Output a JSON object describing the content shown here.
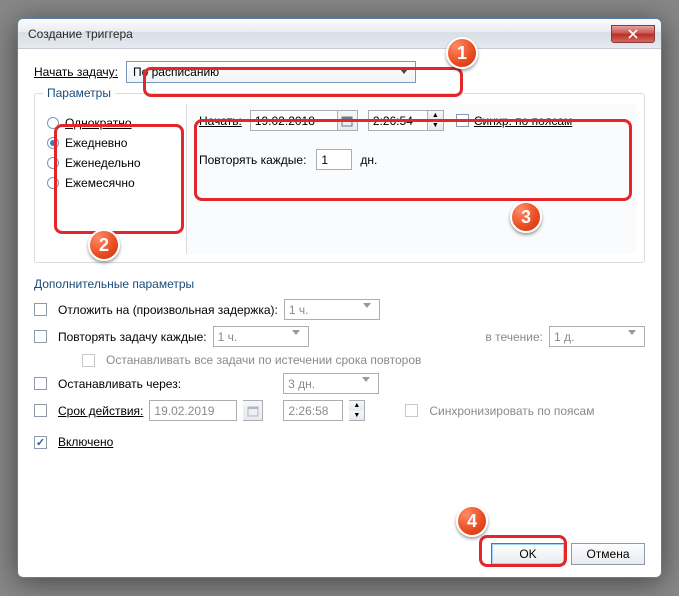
{
  "window": {
    "title": "Создание триггера"
  },
  "begin": {
    "label": "Начать задачу:",
    "value": "По расписанию"
  },
  "params": {
    "legend": "Параметры",
    "radios": [
      {
        "label": "Однократно",
        "checked": false
      },
      {
        "label": "Ежедневно",
        "checked": true
      },
      {
        "label": "Еженедельно",
        "checked": false
      },
      {
        "label": "Ежемесячно",
        "checked": false
      }
    ],
    "start_label": "Начать:",
    "date": "19.02.2018",
    "time": "2:26:54",
    "sync_label": "Синхр. по поясам",
    "repeat_label": "Повторять каждые:",
    "repeat_value": "1",
    "repeat_unit": "дн."
  },
  "advanced": {
    "legend": "Дополнительные параметры",
    "delay_label": "Отложить на (произвольная задержка):",
    "delay_value": "1 ч.",
    "repeat_label": "Повторять задачу каждые:",
    "repeat_value": "1 ч.",
    "duration_label": "в течение:",
    "duration_value": "1 д.",
    "stop_all_label": "Останавливать все задачи по истечении срока повторов",
    "stop_after_label": "Останавливать через:",
    "stop_after_value": "3 дн.",
    "expire_label": "Срок действия:",
    "expire_date": "19.02.2019",
    "expire_time": "2:26:58",
    "sync_label": "Синхронизировать по поясам",
    "enabled_label": "Включено"
  },
  "buttons": {
    "ok": "OK",
    "cancel": "Отмена"
  },
  "callouts": [
    "1",
    "2",
    "3",
    "4"
  ]
}
